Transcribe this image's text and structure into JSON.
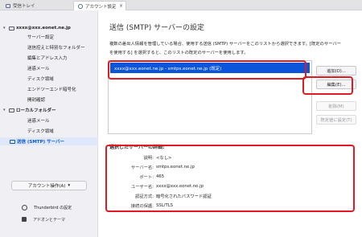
{
  "tabs": [
    {
      "label": "受信トレイ",
      "icon": "mail-icon"
    },
    {
      "label": "アカウント設定",
      "icon": "gear-icon"
    }
  ],
  "sidebar": {
    "items": [
      {
        "label": "xxxx@xxx.eonet.ne.jp",
        "level": 0,
        "expanded": true
      },
      {
        "label": "サーバー設定",
        "level": 1
      },
      {
        "label": "送信控えと特別なフォルダー",
        "level": 1
      },
      {
        "label": "編集とアドレス入力",
        "level": 1
      },
      {
        "label": "迷惑メール",
        "level": 1
      },
      {
        "label": "ディスク領域",
        "level": 1
      },
      {
        "label": "エンドツーエンド暗号化",
        "level": 1
      },
      {
        "label": "開封確認",
        "level": 1
      },
      {
        "label": "ローカルフォルダー",
        "level": 0,
        "expanded": true
      },
      {
        "label": "迷惑メール",
        "level": 1
      },
      {
        "label": "ディスク領域",
        "level": 1
      },
      {
        "label": "送信 (SMTP) サーバー",
        "level": 0,
        "selected": true
      }
    ],
    "account_actions": "アカウント操作(A)",
    "footer": {
      "settings": "Thunderbird の設定",
      "addons": "アドオンとテーマ"
    }
  },
  "main": {
    "title": "送信 (SMTP) サーバーの設定",
    "description_line1": "複数の差出人情報を管理している場合、使用する送信 (SMTP) サーバーをこのリストから選択できます。[既定のサーバー",
    "description_line2": "を使用する] を選択すると、このリストの既定のサーバーを使用します。",
    "servers": [
      {
        "label": "xxxx@xxx.eonet.ne.jp - smtps.eonet.ne.jp (既定)",
        "selected": true
      }
    ],
    "buttons": {
      "add": "追加(D)...",
      "edit": "編集(E)...",
      "remove": "削除(M)",
      "set_default": "既定値に設定(T)"
    },
    "details_title": "選択したサーバーの詳細:",
    "details": [
      {
        "label": "説明:",
        "value": "<なし>"
      },
      {
        "label": "サーバー名:",
        "value": "smtps.eonet.ne.jp"
      },
      {
        "label": "ポート:",
        "value": "465"
      },
      {
        "label": "ユーザー名:",
        "value": "xxxx@xxx.eonet.ne.jp"
      },
      {
        "label": "認証方式:",
        "value": "暗号化されたパスワード認証"
      },
      {
        "label": "接続の保護:",
        "value": "SSL/TLS"
      }
    ]
  },
  "colors": {
    "accent": "#0a55d9",
    "highlight_border": "#e11922",
    "selected_sidebar_bg": "#dfe8fb"
  }
}
